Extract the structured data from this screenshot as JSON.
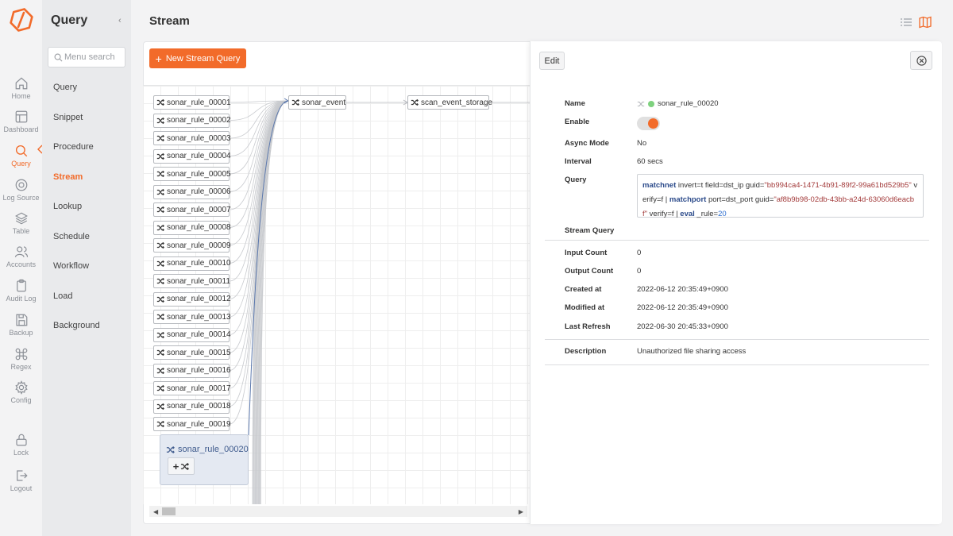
{
  "rail": {
    "items": [
      {
        "label": "Home",
        "icon": "home-icon"
      },
      {
        "label": "Dashboard",
        "icon": "dashboard-icon"
      },
      {
        "label": "Query",
        "icon": "search-icon"
      },
      {
        "label": "Log Source",
        "icon": "target-icon"
      },
      {
        "label": "Table",
        "icon": "layers-icon"
      },
      {
        "label": "Accounts",
        "icon": "users-icon"
      },
      {
        "label": "Audit Log",
        "icon": "clipboard-icon"
      },
      {
        "label": "Backup",
        "icon": "save-icon"
      },
      {
        "label": "Regex",
        "icon": "command-icon"
      },
      {
        "label": "Config",
        "icon": "gear-icon"
      },
      {
        "label": "Lock",
        "icon": "lock-icon"
      },
      {
        "label": "Logout",
        "icon": "logout-icon"
      }
    ]
  },
  "menu": {
    "title": "Query",
    "search_placeholder": "Menu search",
    "items": [
      "Query",
      "Snippet",
      "Procedure",
      "Stream",
      "Lookup",
      "Schedule",
      "Workflow",
      "Load",
      "Background"
    ]
  },
  "header": {
    "title": "Stream"
  },
  "toolbar": {
    "new_stream_label": "New Stream Query"
  },
  "graph": {
    "rules": [
      "sonar_rule_00001",
      "sonar_rule_00002",
      "sonar_rule_00003",
      "sonar_rule_00004",
      "sonar_rule_00005",
      "sonar_rule_00006",
      "sonar_rule_00007",
      "sonar_rule_00008",
      "sonar_rule_00009",
      "sonar_rule_00010",
      "sonar_rule_00011",
      "sonar_rule_00012",
      "sonar_rule_00013",
      "sonar_rule_00014",
      "sonar_rule_00015",
      "sonar_rule_00016",
      "sonar_rule_00017",
      "sonar_rule_00018",
      "sonar_rule_00019"
    ],
    "event_node": "sonar_event",
    "storage_node": "scan_event_storage",
    "selected_node": "sonar_rule_00020"
  },
  "detail": {
    "edit_label": "Edit",
    "labels": {
      "name": "Name",
      "enable": "Enable",
      "async_mode": "Async Mode",
      "interval": "Interval",
      "query": "Query",
      "stream_query": "Stream Query",
      "input_count": "Input Count",
      "output_count": "Output Count",
      "created_at": "Created at",
      "modified_at": "Modified at",
      "last_refresh": "Last Refresh",
      "description": "Description"
    },
    "values": {
      "name": "sonar_rule_00020",
      "enabled": true,
      "async_mode": "No",
      "interval": "60 secs",
      "input_count": "0",
      "output_count": "0",
      "created_at": "2022-06-12 20:35:49+0900",
      "modified_at": "2022-06-12 20:35:49+0900",
      "last_refresh": "2022-06-30 20:45:33+0900",
      "description": "Unauthorized file sharing access"
    },
    "query": {
      "cmd1": "matchnet",
      "part1": " invert=t field=dst_ip guid=",
      "guid1": "\"bb994ca4-1471-4b91-89f2-99a61bd529b5\"",
      "part2": " verify=f | ",
      "cmd2": "matchport",
      "part3": " port=dst_port guid=",
      "guid2": "\"af8b9b98-02db-43bb-a24d-63060d6eacbf\"",
      "part4": " verify=f | ",
      "cmd3": "eval",
      "part5": " _rule=",
      "num": "20"
    }
  },
  "colors": {
    "accent": "#f26b2a",
    "enabled_dot": "#7ed17e",
    "keyword": "#2b4a8a",
    "string": "#a33b3b"
  }
}
